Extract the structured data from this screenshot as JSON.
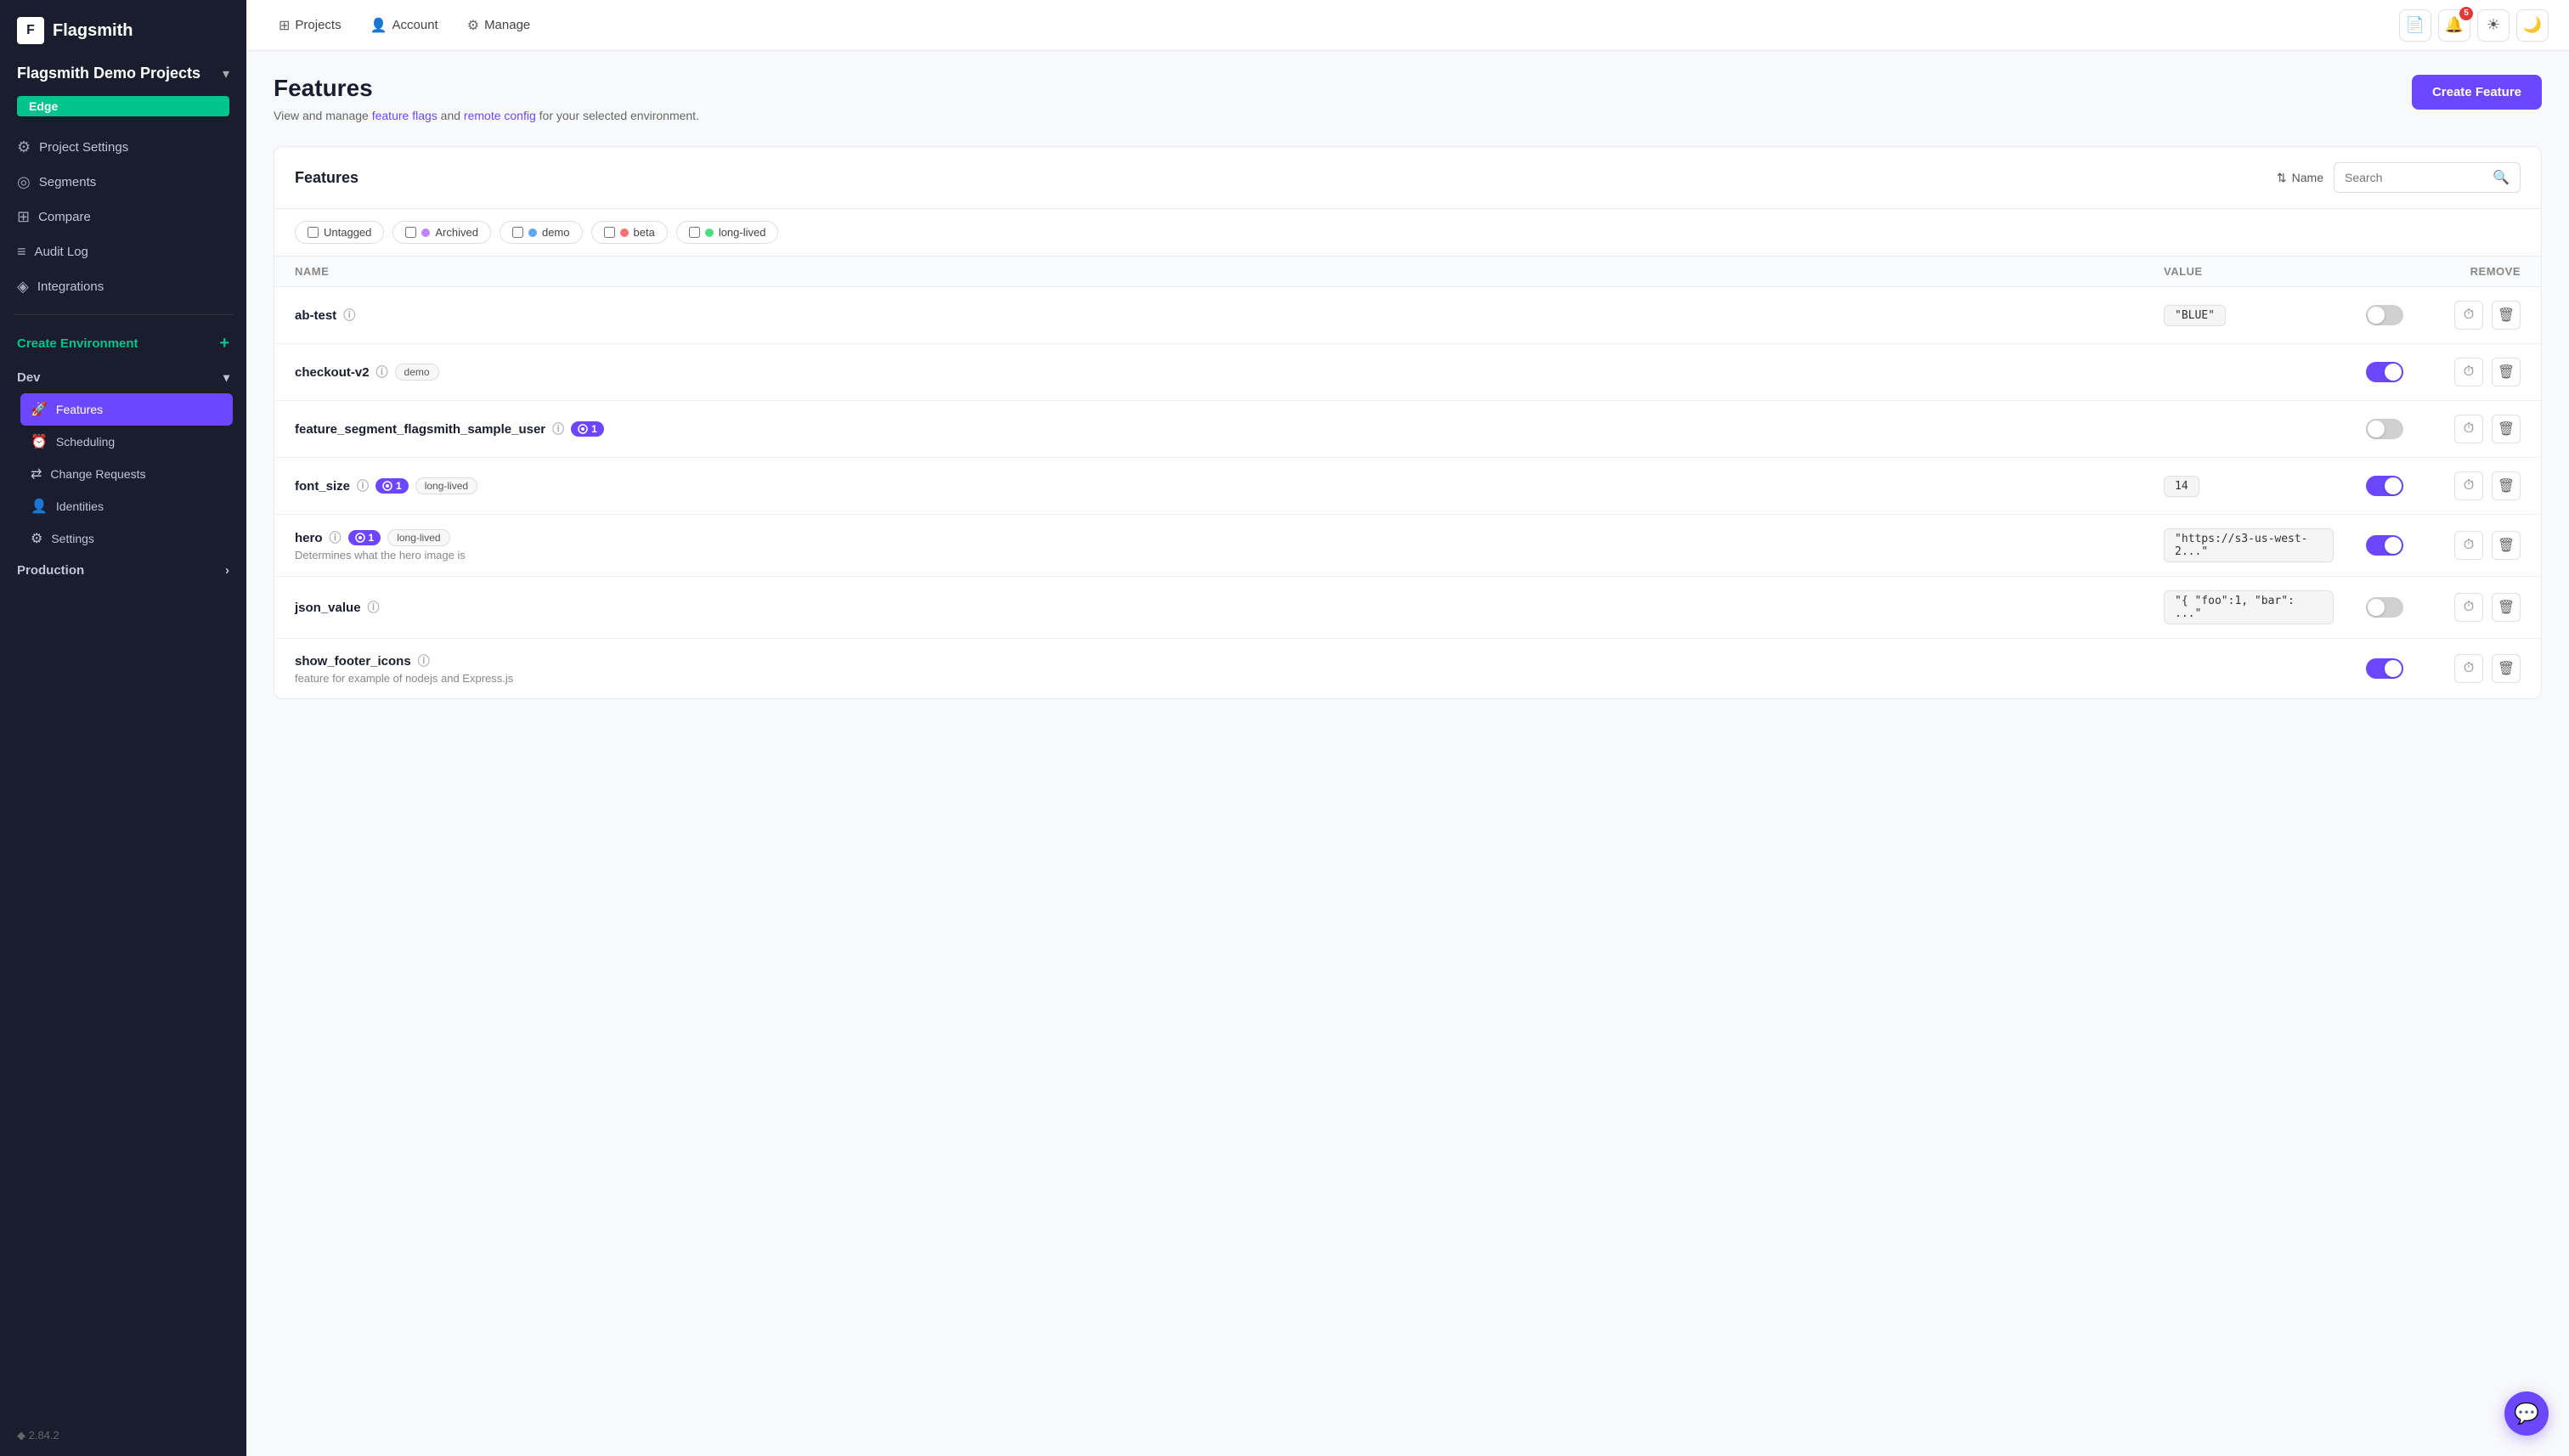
{
  "app": {
    "name": "Flagsmith",
    "version": "2.84.2"
  },
  "nav": {
    "projects_label": "Projects",
    "account_label": "Account",
    "manage_label": "Manage",
    "notifications_count": "5"
  },
  "sidebar": {
    "project_name": "Flagsmith Demo Projects",
    "current_env": "Edge",
    "nav_items": [
      {
        "id": "project-settings",
        "label": "Project Settings",
        "icon": "⚙"
      },
      {
        "id": "segments",
        "label": "Segments",
        "icon": "◎"
      },
      {
        "id": "compare",
        "label": "Compare",
        "icon": "⊞"
      },
      {
        "id": "audit-log",
        "label": "Audit Log",
        "icon": "≡"
      },
      {
        "id": "integrations",
        "label": "Integrations",
        "icon": "◈"
      }
    ],
    "create_env_label": "Create Environment",
    "environments": [
      {
        "id": "dev",
        "label": "Dev",
        "expanded": true,
        "sub_items": [
          {
            "id": "features",
            "label": "Features",
            "icon": "🚀",
            "active": true
          },
          {
            "id": "scheduling",
            "label": "Scheduling",
            "icon": "⏰"
          },
          {
            "id": "change-requests",
            "label": "Change Requests",
            "icon": "⇄"
          },
          {
            "id": "identities",
            "label": "Identities",
            "icon": "👤"
          },
          {
            "id": "settings",
            "label": "Settings",
            "icon": "⚙"
          }
        ]
      },
      {
        "id": "production",
        "label": "Production",
        "expanded": false,
        "sub_items": []
      }
    ]
  },
  "page": {
    "title": "Features",
    "subtitle_before": "View and manage ",
    "feature_flags_link": "feature flags",
    "subtitle_middle": " and ",
    "remote_config_link": "remote config",
    "subtitle_after": " for your selected environment.",
    "create_button": "Create Feature"
  },
  "features_section": {
    "title": "Features",
    "sort_label": "Name",
    "search_placeholder": "Search",
    "tags": [
      {
        "id": "untagged",
        "label": "Untagged",
        "color": null
      },
      {
        "id": "archived",
        "label": "Archived",
        "color": "#e8d0ff"
      },
      {
        "id": "demo",
        "label": "demo",
        "color": "#d0e8ff"
      },
      {
        "id": "beta",
        "label": "beta",
        "color": "#ffd0d0"
      },
      {
        "id": "long-lived",
        "label": "long-lived",
        "color": "#d0ffd8"
      }
    ],
    "table_headers": {
      "name": "Name",
      "value": "Value",
      "toggle": "",
      "remove": "Remove"
    },
    "features": [
      {
        "id": "ab-test",
        "name": "ab-test",
        "description": "",
        "tags": [],
        "segments": 0,
        "value": "\"BLUE\"",
        "enabled": false
      },
      {
        "id": "checkout-v2",
        "name": "checkout-v2",
        "description": "",
        "tags": [
          "demo"
        ],
        "segments": 0,
        "value": "",
        "enabled": true
      },
      {
        "id": "feature_segment_flagsmith_sample_user",
        "name": "feature_segment_flagsmith_sample_user",
        "description": "",
        "tags": [],
        "segments": 1,
        "value": "",
        "enabled": false
      },
      {
        "id": "font_size",
        "name": "font_size",
        "description": "",
        "tags": [
          "long-lived"
        ],
        "segments": 1,
        "value": "14",
        "enabled": true
      },
      {
        "id": "hero",
        "name": "hero",
        "description": "Determines what the hero image is",
        "tags": [
          "long-lived"
        ],
        "segments": 1,
        "value": "\"https://s3-us-west-2...\"",
        "enabled": true
      },
      {
        "id": "json_value",
        "name": "json_value",
        "description": "",
        "tags": [],
        "segments": 0,
        "value": "\"{ \"foo\":1, \"bar\": ...\"",
        "enabled": false
      },
      {
        "id": "show_footer_icons",
        "name": "show_footer_icons",
        "description": "feature for example of nodejs and Express.js",
        "tags": [],
        "segments": 0,
        "value": "",
        "enabled": true
      }
    ]
  }
}
